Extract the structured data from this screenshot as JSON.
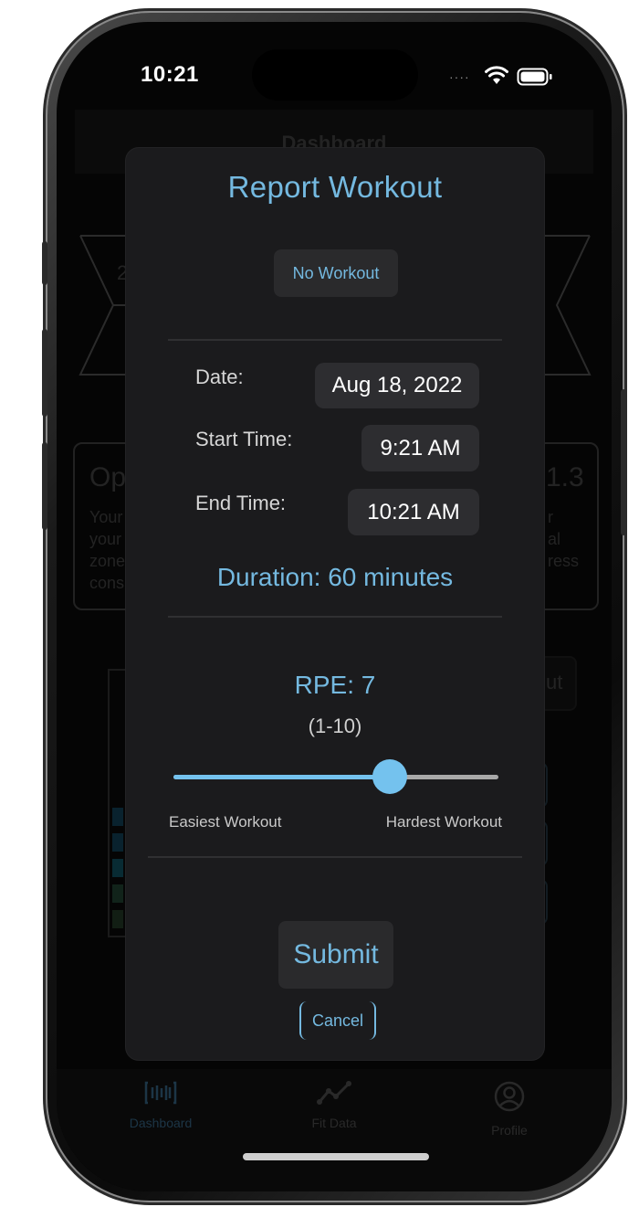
{
  "status_bar": {
    "time": "10:21",
    "signal": "····"
  },
  "background": {
    "header_title": "Dashboard",
    "card_heading": "Op",
    "card_value": "1.3",
    "card_lines": [
      "Your",
      "your",
      "zone",
      "cons"
    ],
    "card_lines_right": [
      "r",
      "al",
      "ress"
    ],
    "side_button_label": "ut"
  },
  "modal": {
    "title": "Report Workout",
    "no_workout_label": "No Workout",
    "date_label": "Date:",
    "date_value": "Aug 18, 2022",
    "start_label": "Start Time:",
    "start_value": "9:21 AM",
    "end_label": "End Time:",
    "end_value": "10:21 AM",
    "duration_text": "Duration: 60 minutes",
    "rpe_text": "RPE: 7",
    "rpe_range_text": "(1-10)",
    "rpe_value": 7,
    "rpe_min": 1,
    "rpe_max": 10,
    "slider_min_label": "Easiest Workout",
    "slider_max_label": "Hardest Workout",
    "submit_label": "Submit",
    "cancel_label": "Cancel"
  },
  "tabbar": {
    "items": [
      {
        "label": "Dashboard",
        "icon": "barcode-icon"
      },
      {
        "label": "Fit Data",
        "icon": "line-chart-icon"
      },
      {
        "label": "Profile",
        "icon": "person-circle-icon"
      }
    ]
  },
  "colors": {
    "accent": "#74b9e0",
    "slider": "#74c2ee",
    "modal_bg": "#1b1b1d",
    "pill_bg": "#2d2d30"
  }
}
